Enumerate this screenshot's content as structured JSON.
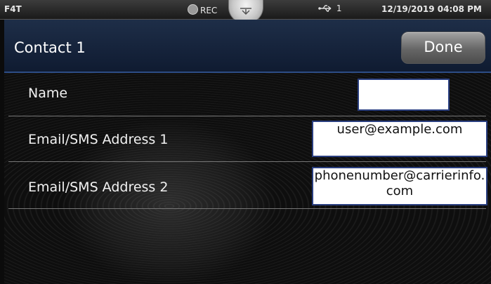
{
  "status_bar": {
    "model": "F4T",
    "rec_label": "REC",
    "usb_label": "1",
    "datetime": "12/19/2019 04:08 PM"
  },
  "header": {
    "title": "Contact 1",
    "done_label": "Done"
  },
  "fields": [
    {
      "label": "Name",
      "value": ""
    },
    {
      "label": "Email/SMS Address 1",
      "value": "user@example.com"
    },
    {
      "label": "Email/SMS Address 2",
      "value": "phonenumber@carrierinfo.com"
    }
  ]
}
